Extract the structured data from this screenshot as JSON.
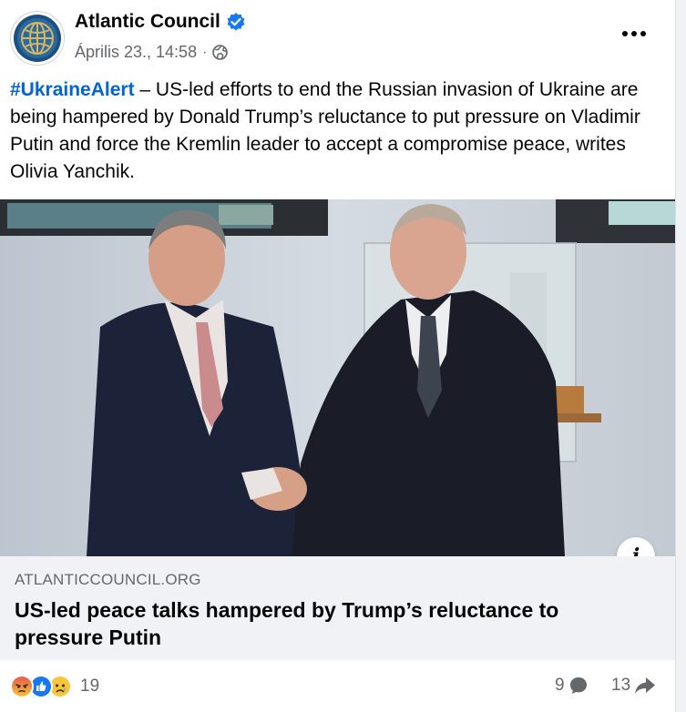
{
  "post": {
    "page_name": "Atlantic Council",
    "verified_icon": "verified-badge-icon",
    "timestamp": "Április 23., 14:58",
    "separator": "·",
    "audience_icon": "globe-icon",
    "more_icon": "more-options-icon",
    "hashtag": "#UkraineAlert",
    "body": " – US-led efforts to end the Russian invasion of Ukraine are being hampered by Donald Trump’s reluctance to put pressure on Vladimir Putin and force the Kremlin leader to accept a compromise peace, writes Olivia Yanchik."
  },
  "link_preview": {
    "domain": "ATLANTICCOUNCIL.ORG",
    "headline": "US-led peace talks hampered by Trump’s reluctance to pressure Putin",
    "info_label": "i"
  },
  "footer": {
    "reaction_icons": [
      "angry-reaction-icon",
      "like-reaction-icon",
      "sad-reaction-icon"
    ],
    "reaction_count": "19",
    "comment_count": "9",
    "share_count": "13"
  },
  "colors": {
    "link_blue": "#0064d1",
    "verified_blue": "#1877f2",
    "secondary_text": "#65676b",
    "link_box_bg": "#f0f2f5"
  }
}
